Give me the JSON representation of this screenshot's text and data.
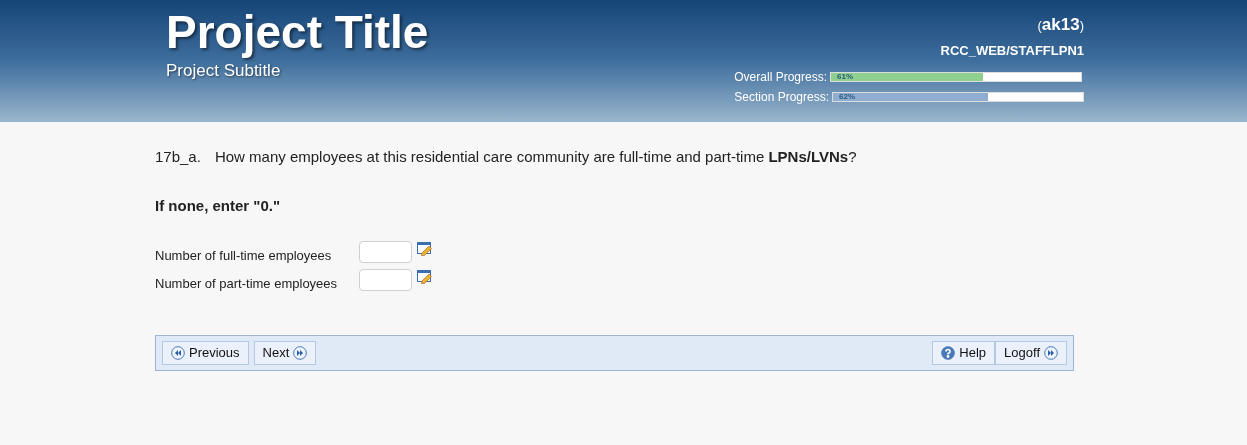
{
  "header": {
    "title": "Project Title",
    "subtitle": "Project Subtitle",
    "user": "ak13",
    "user_open": "(",
    "user_close": ")",
    "path": "RCC_WEB/STAFFLPN1",
    "progress": [
      {
        "label": "Overall Progress:",
        "reading": "61%",
        "level": 0.61,
        "color": "#8fd08f"
      },
      {
        "label": "Section Progress:",
        "reading": "62%",
        "level": 0.62,
        "color": "#8eadd0"
      }
    ]
  },
  "question": {
    "number": "17b_a.",
    "text": "How many employees at this residential care community are full-time and part-time **LPNs/LVNs**?",
    "instruction": "If none, enter \"0.\""
  },
  "fields": [
    {
      "label": "Number of full-time employees"
    },
    {
      "label": "Number of part-time employees"
    }
  ],
  "nav_left": [
    {
      "label": "Previous",
      "kind": "back"
    },
    {
      "label": "Next",
      "kind": "forward"
    }
  ],
  "nav_right": [
    {
      "label": "Help",
      "kind": "help"
    },
    {
      "label": "Logoff",
      "kind": "forward"
    }
  ]
}
